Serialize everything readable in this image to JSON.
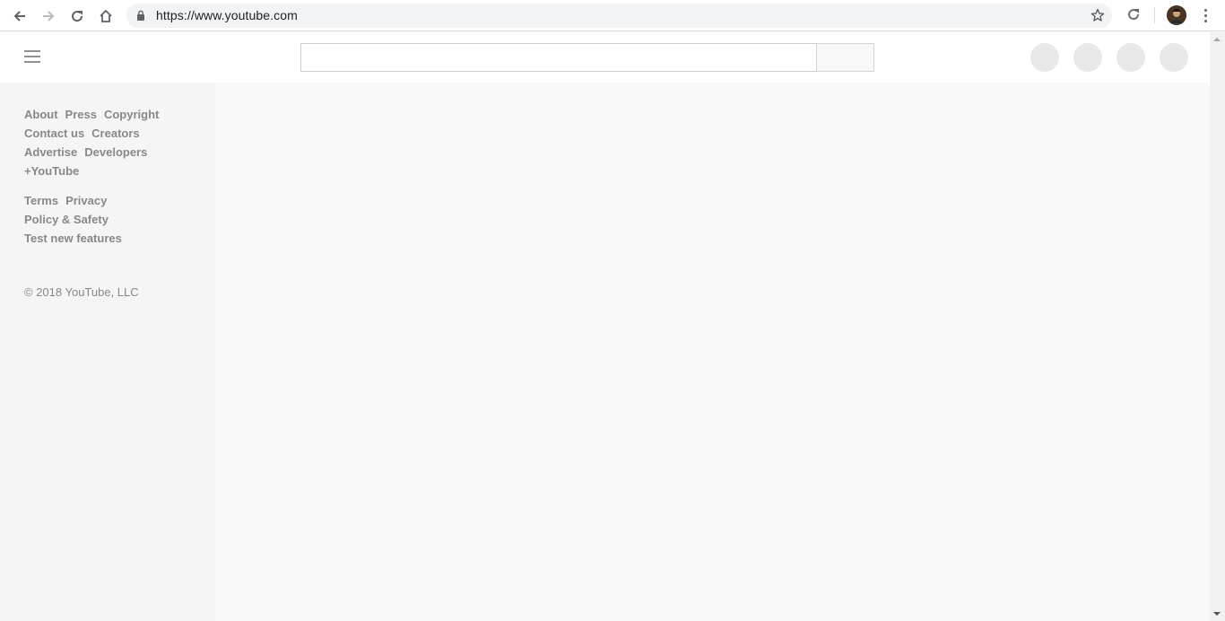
{
  "browser": {
    "url": "https://www.youtube.com"
  },
  "sidebar": {
    "footer_primary": [
      [
        "About",
        "Press",
        "Copyright"
      ],
      [
        "Contact us",
        "Creators"
      ],
      [
        "Advertise",
        "Developers"
      ],
      [
        "+YouTube"
      ]
    ],
    "footer_secondary": [
      [
        "Terms",
        "Privacy"
      ],
      [
        "Policy & Safety"
      ],
      [
        "Test new features"
      ]
    ],
    "copyright": "© 2018 YouTube, LLC"
  },
  "colors": {
    "placeholder_circle": "#e8e8e8",
    "footer_text": "#888888",
    "sidebar_bg": "#f5f5f5",
    "content_bg": "#f9f9f9"
  },
  "icons": {
    "back": "arrow-left-icon",
    "forward": "arrow-right-icon",
    "reload": "reload-icon",
    "home": "home-icon",
    "lock": "lock-icon",
    "bookmark": "star-icon",
    "extension": "sync-extension-icon",
    "menu": "kebab-menu-icon",
    "guide": "hamburger-icon"
  }
}
